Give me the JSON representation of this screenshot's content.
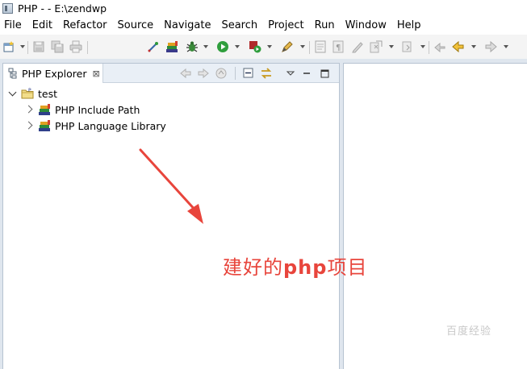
{
  "window": {
    "title": "PHP -  - E:\\zendwp"
  },
  "menu": [
    "File",
    "Edit",
    "Refactor",
    "Source",
    "Navigate",
    "Search",
    "Project",
    "Run",
    "Window",
    "Help"
  ],
  "toolbar": {
    "icons": [
      "new-icon",
      "save-icon",
      "save-all-icon",
      "print-icon",
      "php-element-icon",
      "php-library-icon",
      "debug-icon",
      "run-icon",
      "run-external-icon",
      "edit-icon",
      "doc-icon",
      "paragraph-icon",
      "pen-icon",
      "annotation-nav-icon",
      "last-edit-icon",
      "back-icon",
      "forward-icon"
    ]
  },
  "explorer": {
    "tab_label": "PHP Explorer",
    "tab_close": "⊠",
    "tree": [
      {
        "label": "test",
        "expanded": true,
        "level": 0
      },
      {
        "label": "PHP Include Path",
        "expanded": false,
        "level": 1
      },
      {
        "label": "PHP Language Library",
        "expanded": false,
        "level": 1
      }
    ]
  },
  "annotation": {
    "prefix": "建好的",
    "php": "php",
    "suffix": "项目",
    "color": "#e8453c"
  },
  "watermark": "百度经验"
}
